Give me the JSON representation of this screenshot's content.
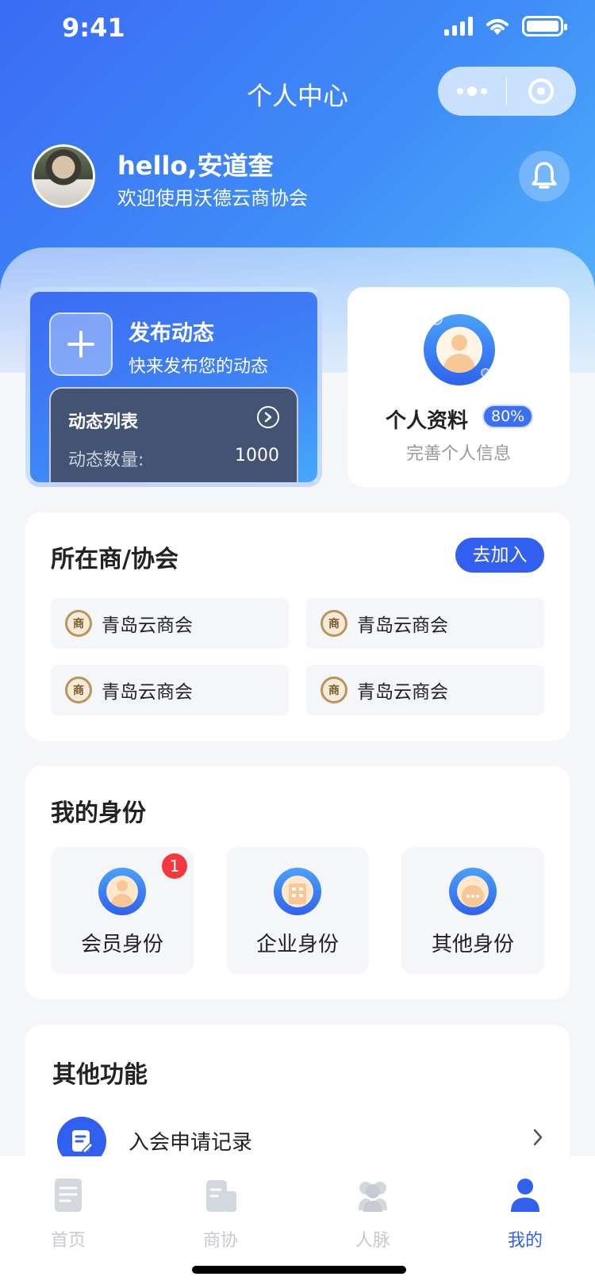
{
  "status_bar": {
    "time": "9:41"
  },
  "nav": {
    "title": "个人中心"
  },
  "user": {
    "greeting": "hello,安道奎",
    "welcome": "欢迎使用沃德云商协会"
  },
  "publish": {
    "title": "发布动态",
    "subtitle": "快来发布您的动态",
    "list_label": "动态列表",
    "count_label": "动态数量:",
    "count_value": "1000"
  },
  "profile": {
    "title": "个人资料",
    "percent": "80%",
    "subtitle": "完善个人信息"
  },
  "associations": {
    "title": "所在商/协会",
    "join_label": "去加入",
    "logo_char": "商",
    "items": [
      {
        "name": "青岛云商会"
      },
      {
        "name": "青岛云商会"
      },
      {
        "name": "青岛云商会"
      },
      {
        "name": "青岛云商会"
      }
    ]
  },
  "identity": {
    "title": "我的身份",
    "items": [
      {
        "label": "会员身份",
        "badge": "1"
      },
      {
        "label": "企业身份"
      },
      {
        "label": "其他身份"
      }
    ]
  },
  "other_functions": {
    "title": "其他功能",
    "items": [
      {
        "label": "入会申请记录"
      }
    ]
  },
  "tabbar": {
    "items": [
      {
        "label": "首页",
        "active": false
      },
      {
        "label": "商协",
        "active": false
      },
      {
        "label": "人脉",
        "active": false
      },
      {
        "label": "我的",
        "active": true
      }
    ]
  },
  "colors": {
    "accent": "#3160f0",
    "badge_red": "#f5383d",
    "tab_inactive": "#c5c9d1"
  }
}
